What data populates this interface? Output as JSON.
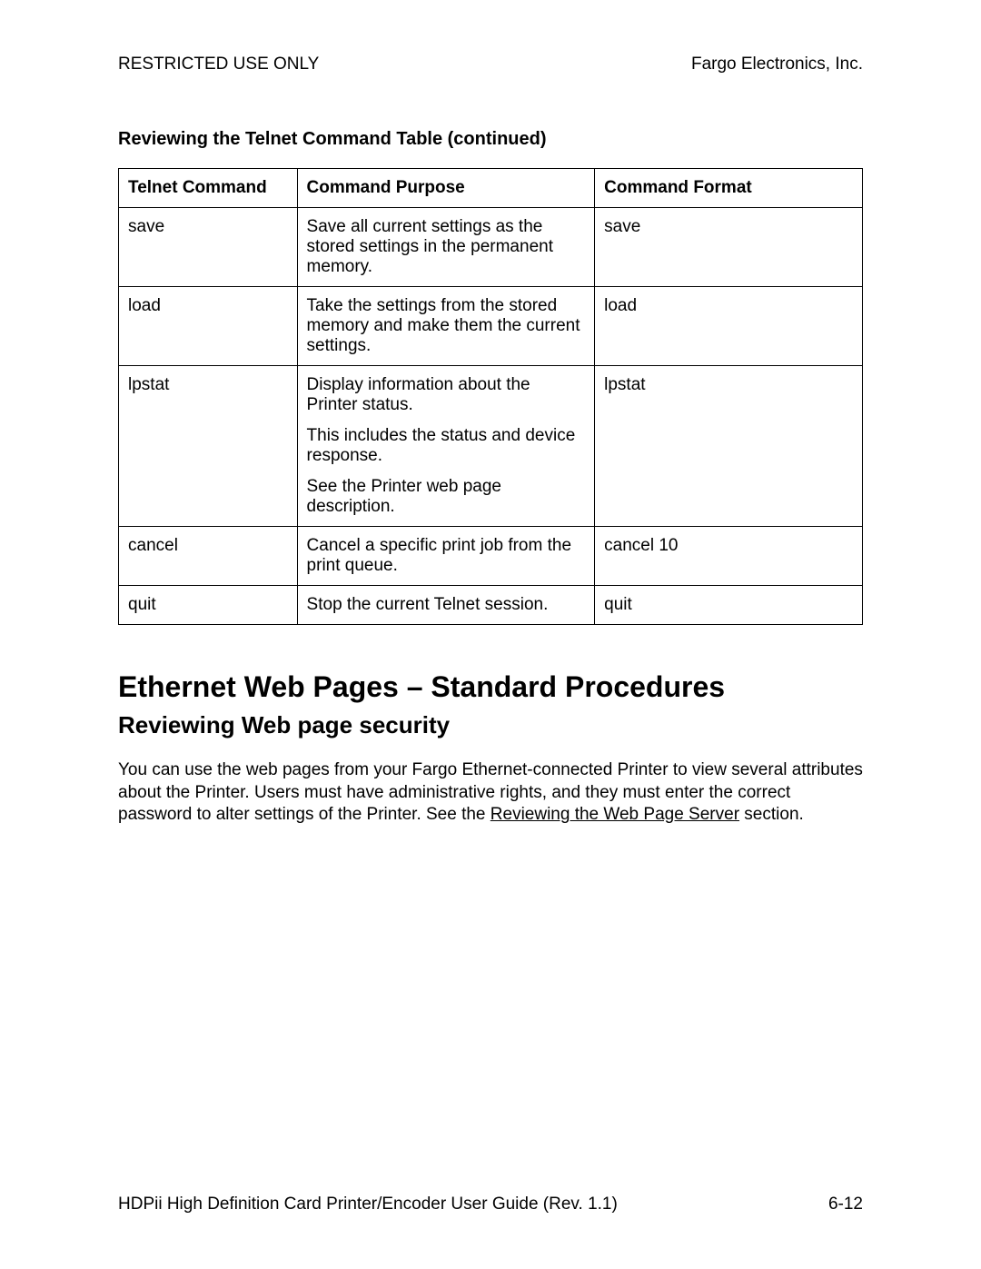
{
  "header": {
    "left": "RESTRICTED USE ONLY",
    "right": "Fargo Electronics, Inc."
  },
  "section_title": "Reviewing the Telnet Command Table (continued)",
  "table": {
    "headers": {
      "command": "Telnet Command",
      "purpose": "Command Purpose",
      "format": "Command Format"
    },
    "rows": [
      {
        "command": "save",
        "purpose": [
          "Save all current settings as the stored settings in the permanent memory."
        ],
        "format": "save"
      },
      {
        "command": "load",
        "purpose": [
          "Take the settings from the stored memory and make them the current settings."
        ],
        "format": "load"
      },
      {
        "command": "lpstat",
        "purpose": [
          "Display information about the Printer status.",
          "This includes the status and device response.",
          "See the Printer web page description."
        ],
        "format": "lpstat"
      },
      {
        "command": "cancel",
        "purpose": [
          "Cancel a specific print job from the print queue."
        ],
        "format": "cancel 10"
      },
      {
        "command": "quit",
        "purpose": [
          "Stop the current Telnet session."
        ],
        "format": "quit"
      }
    ]
  },
  "main_heading": "Ethernet Web Pages – Standard Procedures",
  "sub_heading": "Reviewing Web page security",
  "body_text_pre": "You can use the web pages from your Fargo Ethernet-connected Printer to view several attributes about the Printer. Users must have administrative rights, and they must enter the correct password to alter settings of the Printer. See the ",
  "body_link": "Reviewing the Web Page Server",
  "body_text_post": " section.",
  "footer": {
    "left": "HDPii High Definition Card Printer/Encoder User Guide (Rev. 1.1)",
    "right": "6-12"
  }
}
